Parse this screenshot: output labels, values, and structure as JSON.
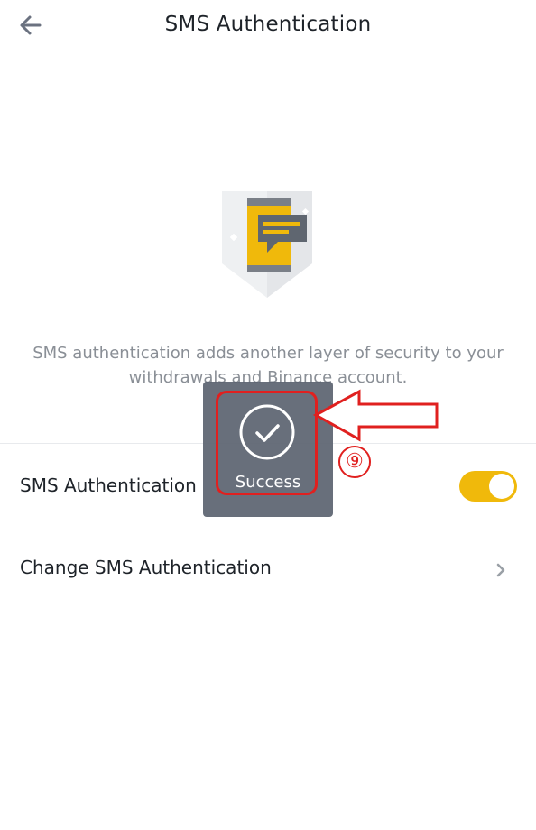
{
  "header": {
    "back_icon": "arrow-left-icon",
    "title": "SMS Authentication"
  },
  "illustration": {
    "icon": "phone-message-shield-icon"
  },
  "description": {
    "line1": "SMS authentication adds another layer of security to your",
    "line2": "withdrawals and Binance account."
  },
  "settings": {
    "sms_toggle_label": "SMS Authentication",
    "sms_toggle_on": true,
    "change_label": "Change SMS Authentication",
    "change_icon": "chevron-right-icon"
  },
  "toast": {
    "icon": "check-circle-icon",
    "text": "Success"
  },
  "annotation": {
    "step_number": "⑨",
    "arrow_icon": "arrow-left-outline-icon"
  },
  "colors": {
    "accent": "#F0B90B",
    "text_primary": "#1E2329",
    "text_secondary": "#8A8F96",
    "toast_bg": "#5B6370",
    "annotation_red": "#E0201F"
  }
}
